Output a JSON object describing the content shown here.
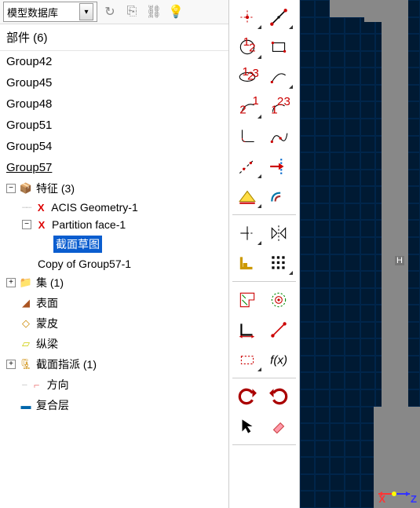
{
  "dropdown": {
    "label": "模型数据库"
  },
  "tree": {
    "header": "部件 (6)",
    "groups": [
      "Group42",
      "Group45",
      "Group48",
      "Group51",
      "Group54",
      "Group57"
    ],
    "features_label": "特征 (3)",
    "acis": "ACIS Geometry-1",
    "partition": "Partition face-1",
    "section_sketch": "截面草图",
    "copy": "Copy of Group57-1",
    "sets": "集 (1)",
    "surface": "表面",
    "skin": "蒙皮",
    "stringer": "纵梁",
    "section_assign": "截面指派 (1)",
    "direction": "方向",
    "composite": "复合层"
  },
  "axes": {
    "x": "X",
    "z": "Z",
    "h": "H"
  }
}
